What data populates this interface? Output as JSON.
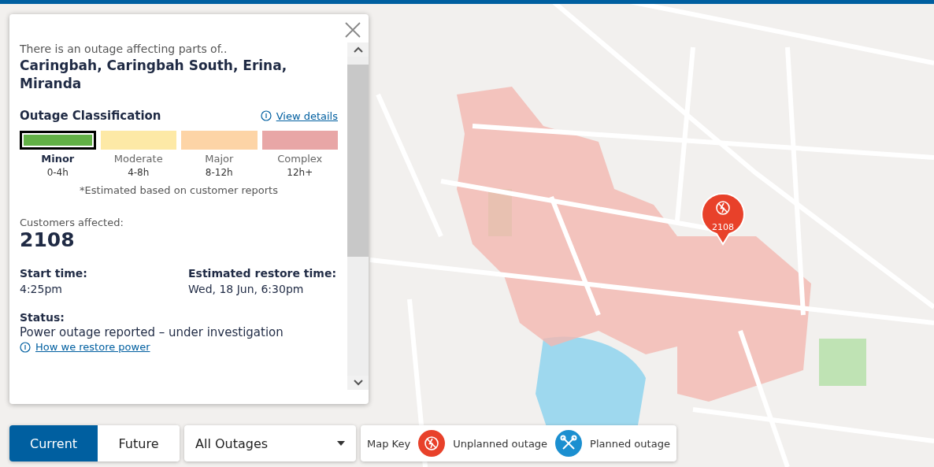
{
  "popup": {
    "intro": "There is an outage affecting parts of..",
    "suburbs": "Caringbah, Caringbah South, Erina, Miranda",
    "classification": {
      "title": "Outage Classification",
      "details_link": "View details",
      "levels": [
        {
          "name": "Minor",
          "range": "0-4h",
          "color": "#62b046",
          "selected": true
        },
        {
          "name": "Moderate",
          "range": "4-8h",
          "color": "#fde9a6",
          "selected": false
        },
        {
          "name": "Major",
          "range": "8-12h",
          "color": "#fdd4a6",
          "selected": false
        },
        {
          "name": "Complex",
          "range": "12h+",
          "color": "#e8a6a6",
          "selected": false
        }
      ],
      "note": "*Estimated based on customer reports"
    },
    "customers_label": "Customers affected:",
    "customers": "2108",
    "start_label": "Start time:",
    "start": "4:25pm",
    "restore_label": "Estimated restore time:",
    "restore": "Wed, 18 Jun, 6:30pm",
    "status_label": "Status:",
    "status": "Power outage reported – under investigation",
    "restore_link": "How we restore power"
  },
  "marker": {
    "count": "2108"
  },
  "controls": {
    "tabs": [
      {
        "label": "Current",
        "selected": true
      },
      {
        "label": "Future",
        "selected": false
      }
    ],
    "filter": {
      "value": "All Outages"
    },
    "map_key": {
      "title": "Map Key",
      "items": [
        {
          "kind": "unplanned",
          "label": "Unplanned outage"
        },
        {
          "kind": "planned",
          "label": "Planned outage"
        }
      ]
    }
  }
}
